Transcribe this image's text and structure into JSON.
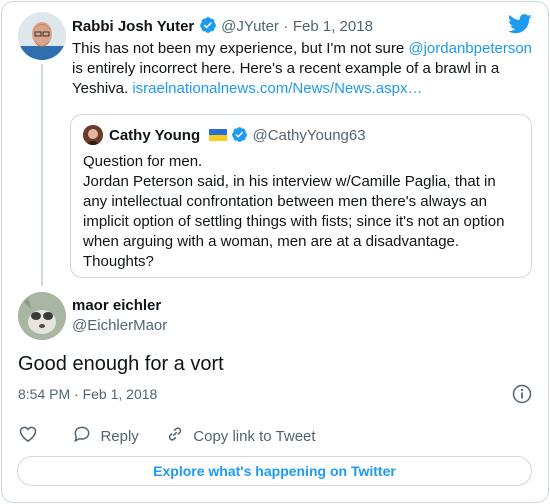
{
  "colors": {
    "accent": "#1d9bf0",
    "text": "#0f1419",
    "muted": "#536471",
    "border": "#cfd9de"
  },
  "tweet": {
    "author_name": "Rabbi Josh Yuter",
    "author_handle": "@JYuter",
    "separator": "·",
    "date": "Feb 1, 2018",
    "text_part1": "This has not been my experience, but I'm not sure ",
    "mention": "@jordanbpeterson",
    "text_part2": " is entirely incorrect here. Here's a recent example of a brawl in a Yeshiva. ",
    "link": "israelnationalnews.com/News/News.aspx…",
    "icons": [
      "verified-badge-icon",
      "twitter-bird-icon"
    ]
  },
  "quote": {
    "author_name": "Cathy Young",
    "author_handle": "@CathyYoung63",
    "line1": "Question for men.",
    "line2": "Jordan Peterson said, in his interview w/Camille Paglia, that in any intellectual confrontation between men there's always an implicit option of settling things with fists; since it's not an option when arguing with a woman, men are at a disadvantage.",
    "line3": "Thoughts?",
    "icons": [
      "ukraine-flag-icon",
      "verified-badge-icon"
    ]
  },
  "reply": {
    "author_name": "maor eichler",
    "author_handle": "@EichlerMaor",
    "text": "Good enough for a vort",
    "timestamp": "8:54 PM · Feb 1, 2018"
  },
  "actions": {
    "like_icon": "heart-icon",
    "reply_label": "Reply",
    "copy_link_label": "Copy link to Tweet"
  },
  "footer": {
    "explore_label": "Explore what's happening on Twitter"
  }
}
